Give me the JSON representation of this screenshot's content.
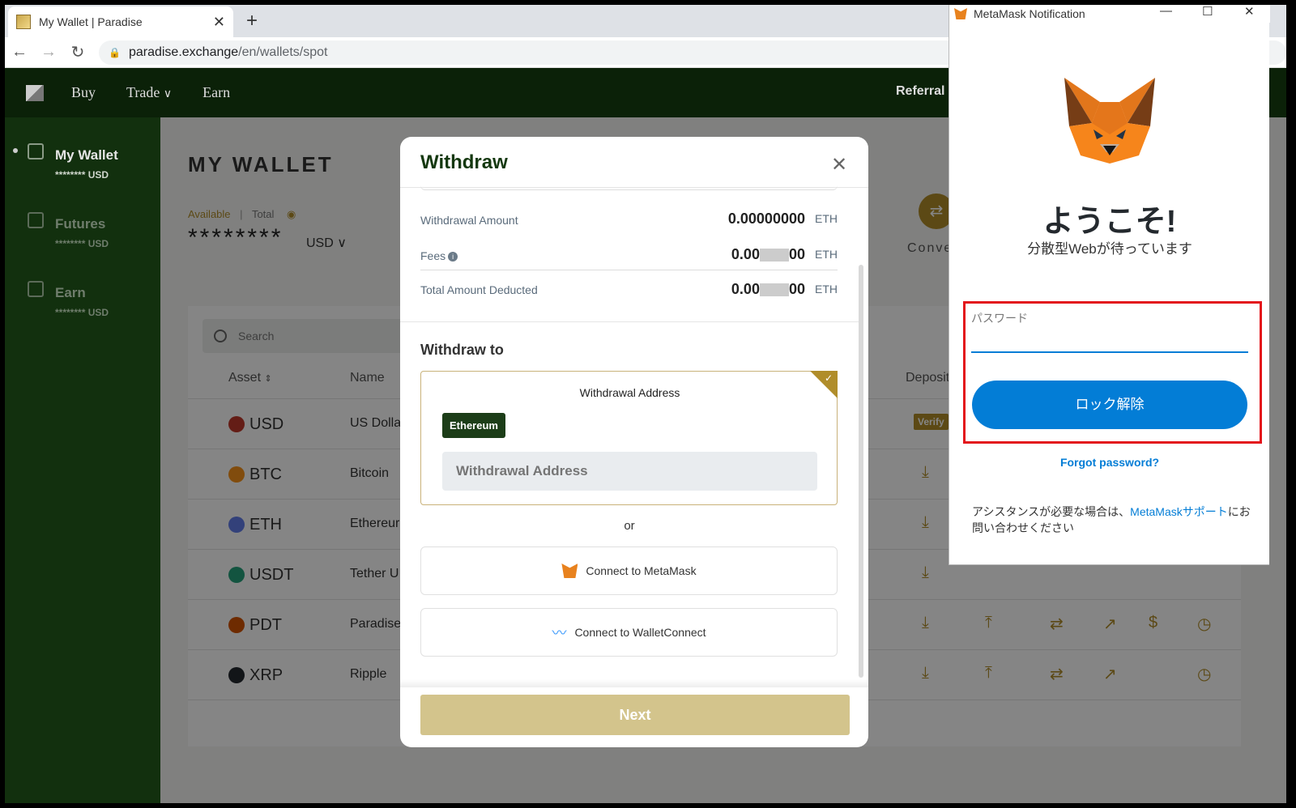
{
  "browser": {
    "tab_title": "My Wallet | Paradise",
    "url_host": "paradise.exchange",
    "url_path": "/en/wallets/spot",
    "new_tab": "+",
    "close_tab": "✕"
  },
  "header": {
    "nav": [
      "Buy",
      "Trade",
      "Earn"
    ],
    "trade_chevron": "⌄",
    "referral": "Referral"
  },
  "sidebar": {
    "items": [
      {
        "label": "My Wallet",
        "sub": "******** USD"
      },
      {
        "label": "Futures",
        "sub": "******** USD"
      },
      {
        "label": "Earn",
        "sub": "******** USD"
      }
    ]
  },
  "wallet": {
    "title": "MY WALLET",
    "available": "Available",
    "total": "Total",
    "balance": "********",
    "currency": "USD",
    "convert": "Conve",
    "search_placeholder": "Search",
    "columns": {
      "asset": "Asset",
      "name": "Name",
      "deposit": "Deposit"
    },
    "rows": [
      {
        "symbol": "USD",
        "name": "US Dolla",
        "color": "#c0392b"
      },
      {
        "symbol": "BTC",
        "name": "Bitcoin",
        "color": "#f7931a"
      },
      {
        "symbol": "ETH",
        "name": "Ethereur",
        "color": "#627eea"
      },
      {
        "symbol": "USDT",
        "name": "Tether U",
        "color": "#26a17b"
      },
      {
        "symbol": "PDT",
        "name": "Paradise",
        "color": "#d35400"
      },
      {
        "symbol": "XRP",
        "name": "Ripple",
        "color": "#23292f"
      }
    ],
    "verify": "Verify"
  },
  "withdraw": {
    "title": "Withdraw",
    "amount_label": "Withdrawal Amount",
    "amount_value": "0.00000000",
    "fees_label": "Fees",
    "fees_prefix": "0.00",
    "fees_suffix": "00",
    "total_label": "Total Amount Deducted",
    "total_prefix": "0.00",
    "total_suffix": "00",
    "unit": "ETH",
    "withdraw_to": "Withdraw to",
    "address_title": "Withdrawal Address",
    "network_chip": "Ethereum",
    "address_placeholder": "Withdrawal Address",
    "or": "or",
    "metamask_btn": "Connect to MetaMask",
    "walletconnect_btn": "Connect to WalletConnect",
    "next": "Next"
  },
  "metamask": {
    "window_title": "MetaMask Notification",
    "welcome": "ようこそ!",
    "subtitle": "分散型Webが待っています",
    "password_label": "パスワード",
    "unlock": "ロック解除",
    "forgot": "Forgot password?",
    "assist_prefix": "アシスタンスが必要な場合は、",
    "assist_link": "MetaMaskサポート",
    "assist_suffix": "にお問い合わせください"
  },
  "colors": {
    "brand_dark": "#0b2108",
    "gold": "#b08d2a",
    "metamask_blue": "#037dd6",
    "highlight_red": "#e3141b"
  }
}
